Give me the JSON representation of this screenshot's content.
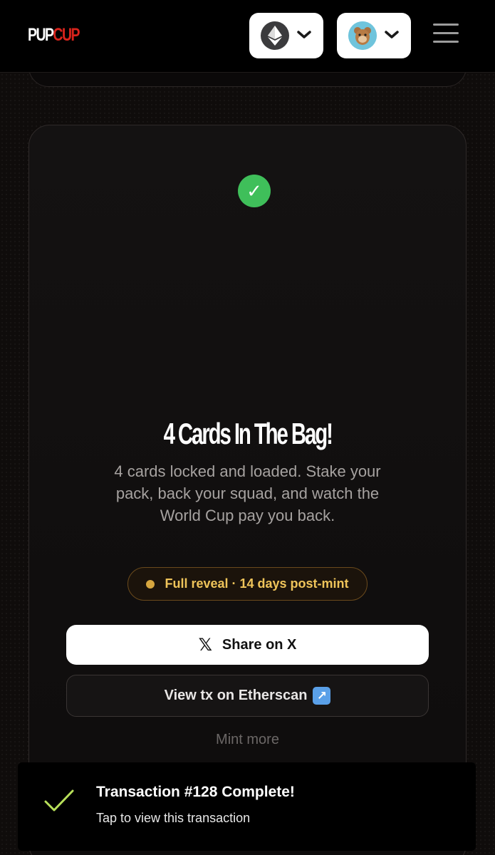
{
  "header": {
    "logo_part1": "PUP",
    "logo_part2": "CUP",
    "chain_icon": "ethereum-icon",
    "account_icon": "monkey-avatar"
  },
  "card": {
    "title": "4 Cards In The Bag!",
    "description": "4 cards locked and loaded. Stake your pack, back your squad, and watch the World Cup pay you back.",
    "reveal_badge": "Full reveal · 14 days post-mint",
    "share_label": "Share on X",
    "etherscan_label": "View tx on Etherscan",
    "mint_more_label": "Mint more"
  },
  "toast": {
    "title": "Transaction #128 Complete!",
    "subtitle": "Tap to view this transaction"
  },
  "colors": {
    "success_green": "#3fbf5a",
    "brand_red": "#d9241c",
    "reveal_gold": "#efc45a",
    "toast_check": "#b8e05a"
  }
}
